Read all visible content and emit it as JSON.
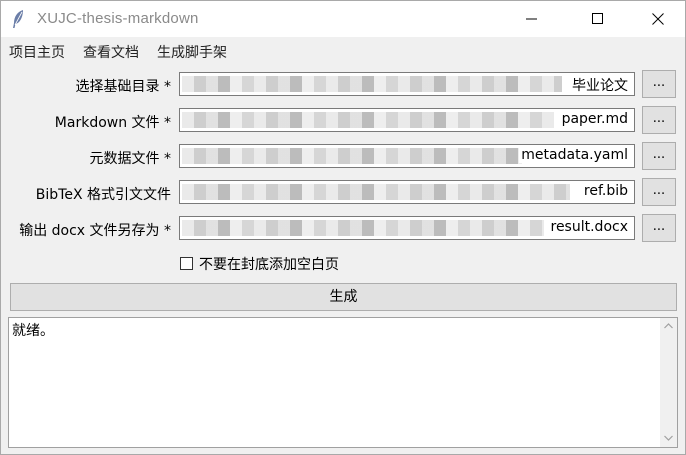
{
  "window": {
    "title": "XUJC-thesis-markdown",
    "icon": "feather-icon"
  },
  "menubar": {
    "items": [
      {
        "label": "项目主页"
      },
      {
        "label": "查看文档"
      },
      {
        "label": "生成脚手架"
      }
    ]
  },
  "form": {
    "rows": [
      {
        "label": "选择基础目录 *",
        "value_visible": "毕业论文",
        "button": "..."
      },
      {
        "label": "Markdown 文件 *",
        "value_visible": "paper.md",
        "button": "..."
      },
      {
        "label": "元数据文件 *",
        "value_visible": "metadata.yaml",
        "button": "..."
      },
      {
        "label": "BibTeX 格式引文文件",
        "value_visible": "ref.bib",
        "button": "..."
      },
      {
        "label": "输出 docx 文件另存为 *",
        "value_visible": "result.docx",
        "button": "..."
      }
    ],
    "checkbox": {
      "label": "不要在封底添加空白页",
      "checked": false
    },
    "generate_button": "生成"
  },
  "log": {
    "text": "就绪。"
  }
}
